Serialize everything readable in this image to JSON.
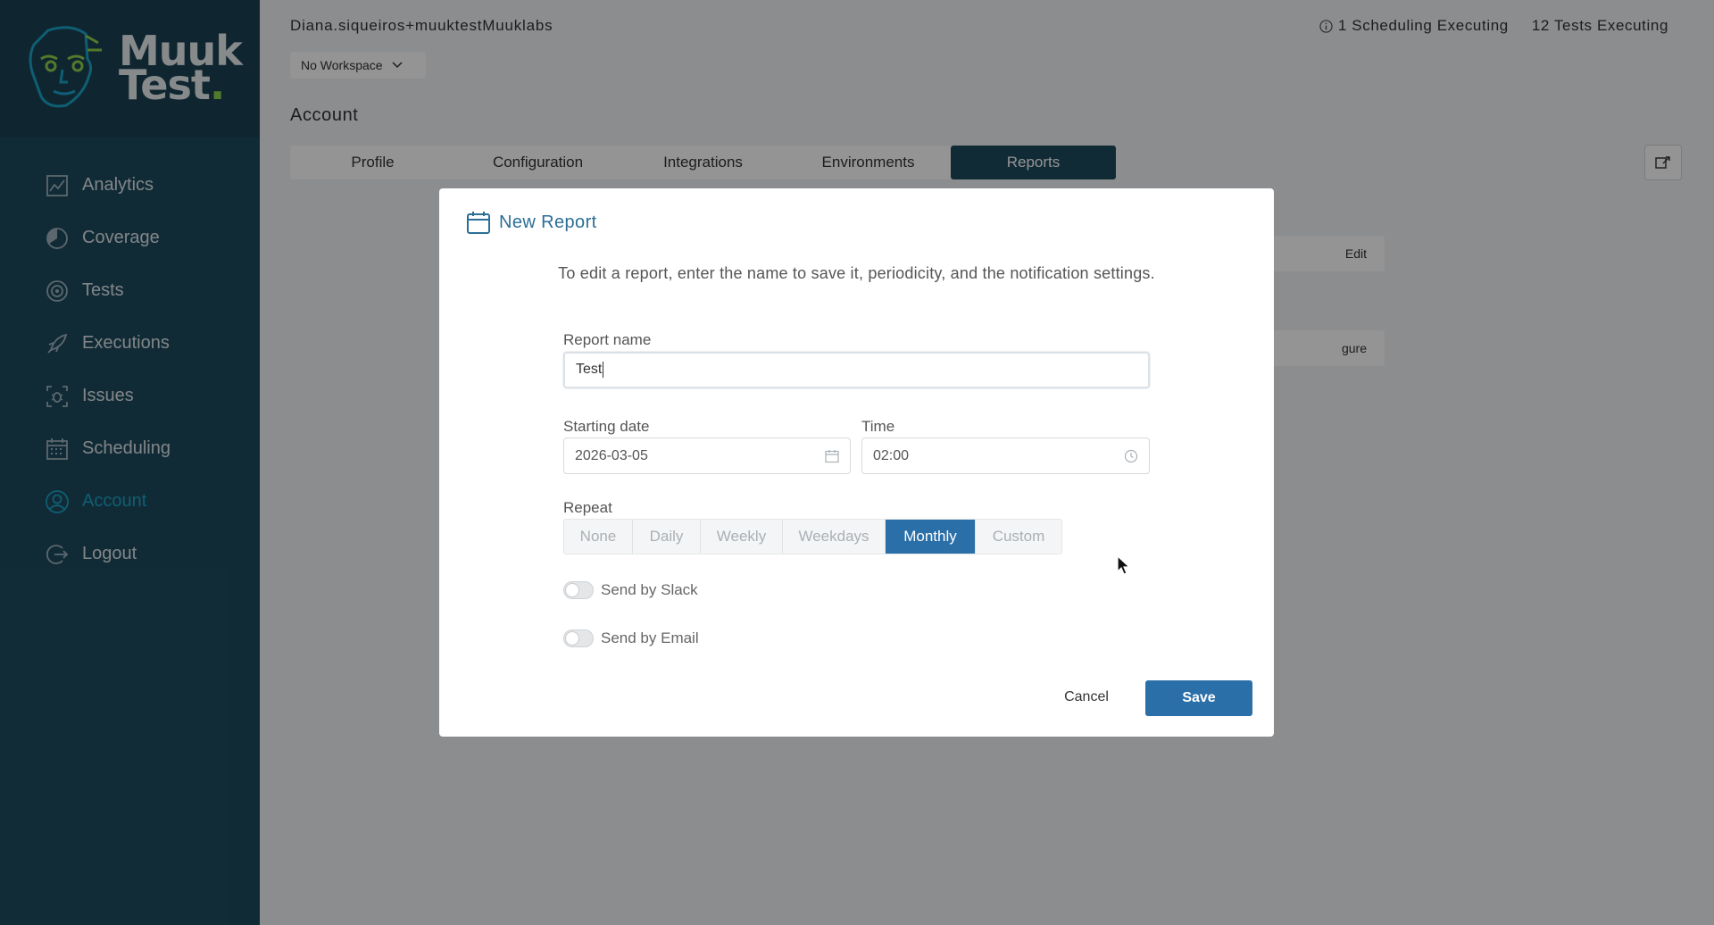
{
  "brand": {
    "line1": "Muuk",
    "line2": "Test",
    "mark": "."
  },
  "sidebar": {
    "items": [
      {
        "label": "Analytics",
        "icon": "analytics-icon"
      },
      {
        "label": "Coverage",
        "icon": "coverage-icon"
      },
      {
        "label": "Tests",
        "icon": "tests-icon"
      },
      {
        "label": "Executions",
        "icon": "rocket-icon"
      },
      {
        "label": "Issues",
        "icon": "bug-icon"
      },
      {
        "label": "Scheduling",
        "icon": "calendar-icon"
      },
      {
        "label": "Account",
        "icon": "user-icon",
        "active": true
      },
      {
        "label": "Logout",
        "icon": "logout-icon"
      }
    ]
  },
  "header": {
    "user": "Diana.siqueiros+muuktestMuuklabs",
    "scheduling": "1 Scheduling Executing",
    "tests": "12 Tests Executing",
    "workspace": "No Workspace"
  },
  "page": {
    "title": "Account",
    "tabs": [
      "Profile",
      "Configuration",
      "Integrations",
      "Environments",
      "Reports"
    ],
    "active_tab": "Reports",
    "bg_edit": "Edit",
    "bg_configure": "gure"
  },
  "modal": {
    "title": "New Report",
    "description": "To edit a report, enter the name to save it, periodicity, and the notification settings.",
    "report_name_label": "Report name",
    "report_name_value": "Test",
    "starting_date_label": "Starting date",
    "starting_date_value": "2026-03-05",
    "time_label": "Time",
    "time_value": "02:00",
    "repeat_label": "Repeat",
    "repeat_options": [
      "None",
      "Daily",
      "Weekly",
      "Weekdays",
      "Monthly",
      "Custom"
    ],
    "repeat_selected": "Monthly",
    "slack_label": "Send by Slack",
    "email_label": "Send by Email",
    "cancel_label": "Cancel",
    "save_label": "Save"
  },
  "colors": {
    "sidebar": "#1e4a5e",
    "accent": "#2b6fa8",
    "active_nav": "#1aa3c7"
  }
}
